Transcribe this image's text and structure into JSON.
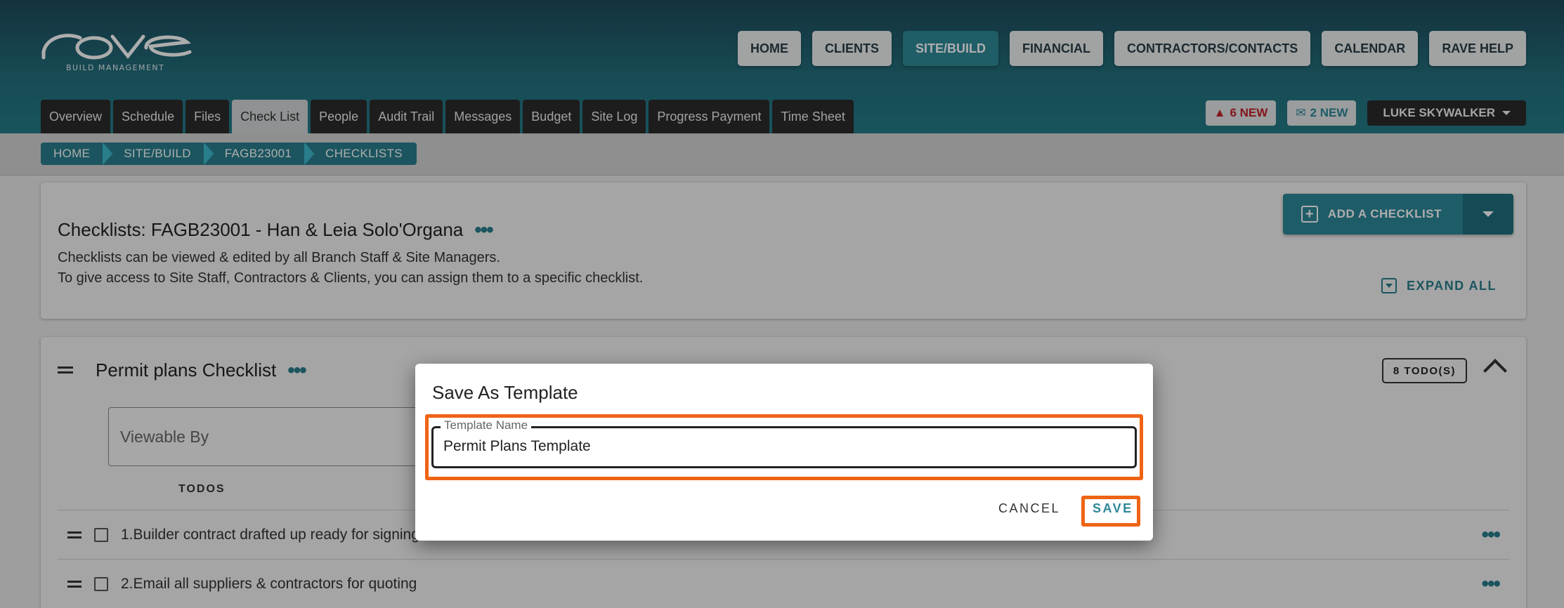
{
  "brand": {
    "logo_text": "rave",
    "logo_sub": "BUILD MANAGEMENT"
  },
  "top_nav": [
    {
      "label": "HOME",
      "active": false
    },
    {
      "label": "CLIENTS",
      "active": false
    },
    {
      "label": "SITE/BUILD",
      "active": true
    },
    {
      "label": "FINANCIAL",
      "active": false
    },
    {
      "label": "CONTRACTORS/CONTACTS",
      "active": false
    },
    {
      "label": "CALENDAR",
      "active": false
    },
    {
      "label": "RAVE HELP",
      "active": false
    }
  ],
  "sub_tabs": [
    {
      "label": "Overview",
      "active": false
    },
    {
      "label": "Schedule",
      "active": false
    },
    {
      "label": "Files",
      "active": false
    },
    {
      "label": "Check List",
      "active": true
    },
    {
      "label": "People",
      "active": false
    },
    {
      "label": "Audit Trail",
      "active": false
    },
    {
      "label": "Messages",
      "active": false
    },
    {
      "label": "Budget",
      "active": false
    },
    {
      "label": "Site Log",
      "active": false
    },
    {
      "label": "Progress Payment",
      "active": false
    },
    {
      "label": "Time Sheet",
      "active": false
    }
  ],
  "header_right": {
    "alerts_label": "6 NEW",
    "messages_label": "2 NEW",
    "user_name": "LUKE SKYWALKER"
  },
  "breadcrumb": [
    "HOME",
    "SITE/BUILD",
    "FAGB23001",
    "CHECKLISTS"
  ],
  "checklists_card": {
    "title": "Checklists: FAGB23001 - Han & Leia Solo'Organa",
    "desc_line1": "Checklists can be viewed & edited by all Branch Staff & Site Managers.",
    "desc_line2": "To give access to Site Staff, Contractors & Clients, you can assign them to a specific checklist.",
    "add_label": "ADD A CHECKLIST",
    "expand_label": "EXPAND ALL"
  },
  "permit_checklist": {
    "title": "Permit plans Checklist",
    "todo_count": "8 TODO(S)",
    "viewable_placeholder": "Viewable By",
    "todos_header": "TODOS",
    "todos": [
      "1.Builder contract drafted up ready for signing",
      "2.Email all suppliers & contractors for quoting"
    ]
  },
  "dialog": {
    "title": "Save As Template",
    "field_label": "Template Name",
    "field_value": "Permit Plans Template",
    "cancel_label": "CANCEL",
    "save_label": "SAVE"
  },
  "colors": {
    "accent": "#2d8899",
    "highlight": "#ef6414",
    "header_dark": "#1d4a5a"
  }
}
